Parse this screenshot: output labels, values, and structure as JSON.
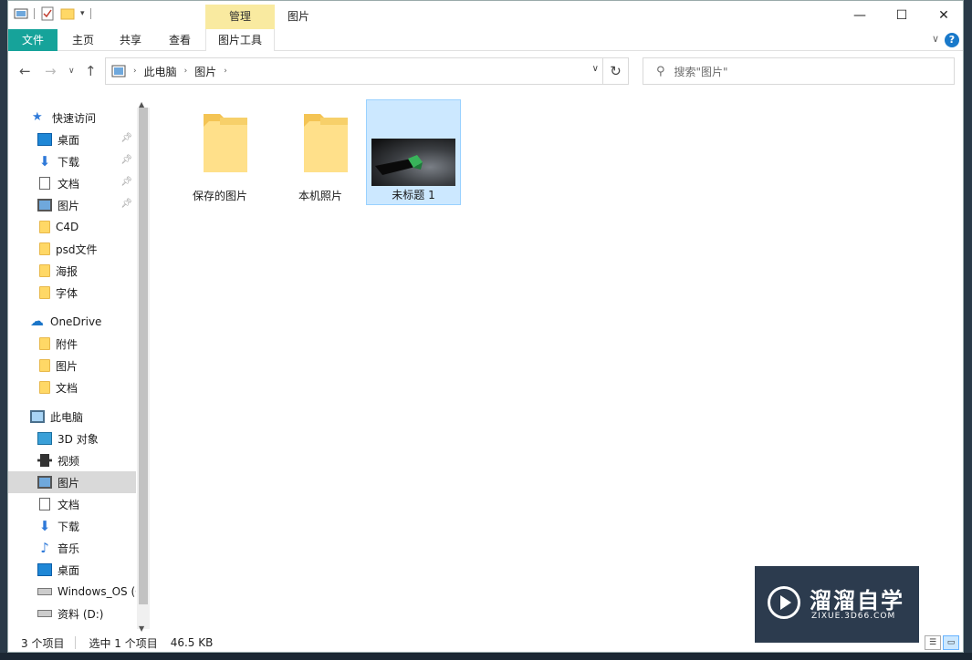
{
  "titlebar": {
    "context_tab": "管理",
    "title": "图片",
    "minimize": "—",
    "maximize": "☐",
    "close": "✕"
  },
  "ribbon": {
    "tabs": [
      "文件",
      "主页",
      "共享",
      "查看",
      "图片工具"
    ],
    "help": "?"
  },
  "address": {
    "crumbs": [
      "此电脑",
      "图片"
    ],
    "search_placeholder": "搜索\"图片\""
  },
  "sidebar": {
    "items": [
      {
        "label": "快速访问",
        "icon": "star-icon"
      },
      {
        "label": "桌面",
        "icon": "desktop-icon",
        "pinned": true
      },
      {
        "label": "下载",
        "icon": "download-icon",
        "pinned": true
      },
      {
        "label": "文档",
        "icon": "document-icon",
        "pinned": true
      },
      {
        "label": "图片",
        "icon": "pictures-icon",
        "pinned": true
      },
      {
        "label": "C4D",
        "icon": "folder-icon"
      },
      {
        "label": "psd文件",
        "icon": "folder-icon"
      },
      {
        "label": "海报",
        "icon": "folder-icon"
      },
      {
        "label": "字体",
        "icon": "folder-icon"
      },
      {
        "label": "OneDrive",
        "icon": "cloud-icon"
      },
      {
        "label": "附件",
        "icon": "folder-icon"
      },
      {
        "label": "图片",
        "icon": "folder-icon"
      },
      {
        "label": "文档",
        "icon": "folder-icon"
      },
      {
        "label": "此电脑",
        "icon": "computer-icon"
      },
      {
        "label": "3D 对象",
        "icon": "3d-objects-icon"
      },
      {
        "label": "视频",
        "icon": "video-icon"
      },
      {
        "label": "图片",
        "icon": "pictures-icon",
        "selected": true
      },
      {
        "label": "文档",
        "icon": "document-icon"
      },
      {
        "label": "下载",
        "icon": "download-icon"
      },
      {
        "label": "音乐",
        "icon": "music-icon"
      },
      {
        "label": "桌面",
        "icon": "desktop-icon"
      },
      {
        "label": "Windows_OS (C",
        "icon": "drive-icon"
      },
      {
        "label": "资料 (D:)",
        "icon": "drive-icon"
      }
    ]
  },
  "content": {
    "items": [
      {
        "label": "保存的图片",
        "type": "folder"
      },
      {
        "label": "本机照片",
        "type": "folder"
      },
      {
        "label": "未标题 1",
        "type": "image",
        "selected": true
      }
    ]
  },
  "status": {
    "count": "3 个项目",
    "selection": "选中 1 个项目",
    "size": "46.5 KB"
  },
  "watermark": {
    "brand": "溜溜自学",
    "url": "ZIXUE.3D66.COM"
  },
  "colors": {
    "file_tab": "#16a39a",
    "context_tab": "#f9eaa0",
    "selection": "#cce8ff",
    "folder": "#ffd866"
  }
}
